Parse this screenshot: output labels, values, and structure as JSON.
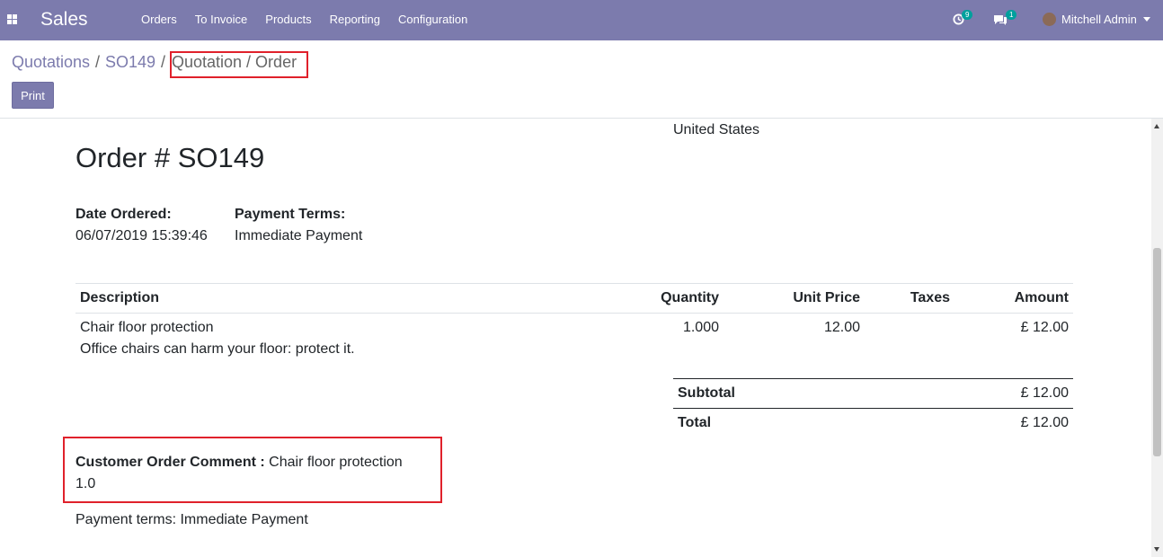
{
  "nav": {
    "app": "Sales",
    "menu": [
      "Orders",
      "To Invoice",
      "Products",
      "Reporting",
      "Configuration"
    ],
    "activity_count": "9",
    "message_count": "1",
    "user": "Mitchell Admin"
  },
  "breadcrumb": {
    "items": [
      "Quotations",
      "SO149",
      "Quotation / Order"
    ],
    "sep": "/"
  },
  "print_label": "Print",
  "doc": {
    "address_line": "United States",
    "title": "Order # SO149",
    "date_label": "Date Ordered:",
    "date_value": "06/07/2019 15:39:46",
    "terms_label": "Payment Terms:",
    "terms_value": "Immediate Payment",
    "table": {
      "headers": [
        "Description",
        "Quantity",
        "Unit Price",
        "Taxes",
        "Amount"
      ],
      "row": {
        "name": "Chair floor protection",
        "desc": "Office chairs can harm your floor: protect it.",
        "qty": "1.000",
        "price": "12.00",
        "taxes": "",
        "amount": "£ 12.00"
      }
    },
    "subtotal_label": "Subtotal",
    "subtotal_value": "£ 12.00",
    "total_label": "Total",
    "total_value": "£ 12.00",
    "comment_label": "Customer Order Comment :",
    "comment_value": "Chair floor protection",
    "comment_line2": "1.0",
    "payment_terms_note": "Payment terms: Immediate Payment"
  },
  "colors": {
    "brand": "#7c7bad",
    "badge": "#00a09d",
    "highlight": "#e0212b"
  }
}
